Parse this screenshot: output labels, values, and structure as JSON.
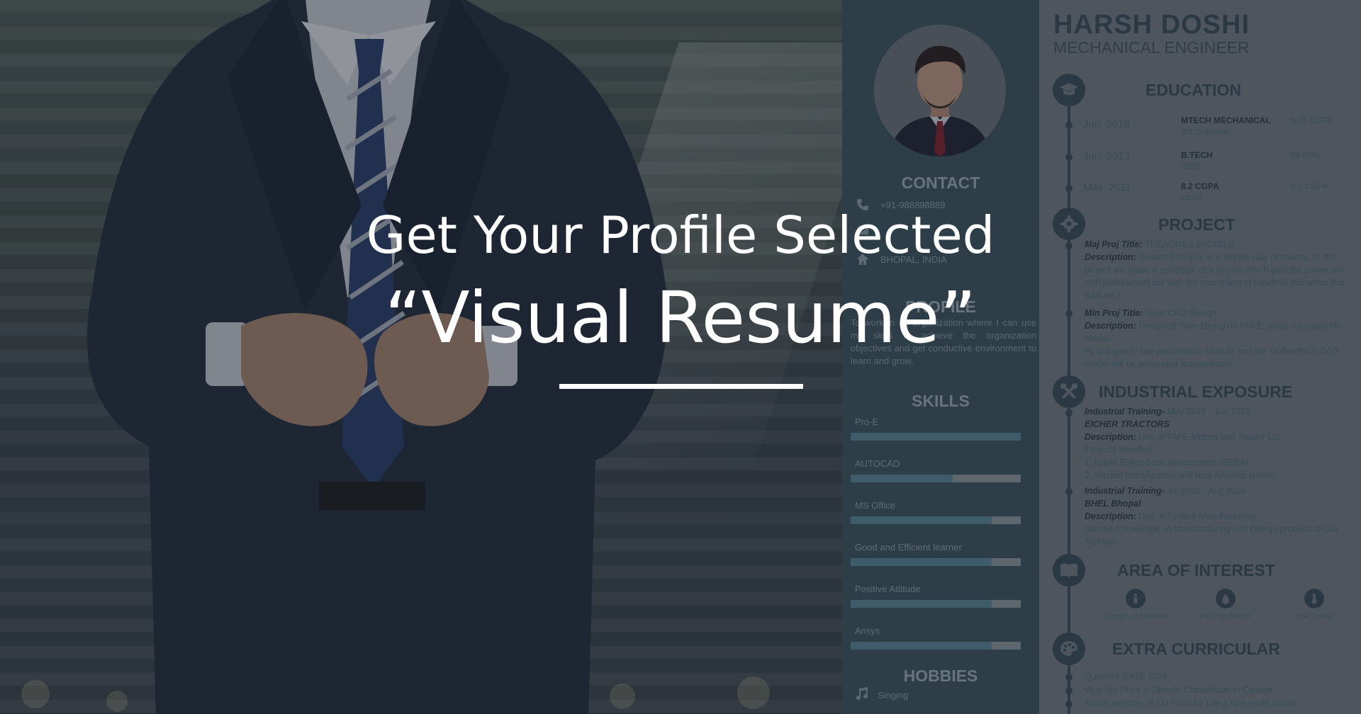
{
  "hero": {
    "headline": "Get Your Profile Selected",
    "subhead": "“Visual Resume”"
  },
  "resume": {
    "name": "HARSH DOSHI",
    "role": "MECHANICAL ENGINEER",
    "sidebar": {
      "contact_heading": "CONTACT",
      "phone": "+91-988898889",
      "location": "BHOPAL, INDIA",
      "profile_heading": "PROFILE",
      "profile_text": "To work in an organization where I can use my skills to achieve the organization objectives and get conductive environment to learn and grow.",
      "skills_heading": "SKILLS",
      "skills": [
        {
          "name": "Pro-E",
          "level": 1.0
        },
        {
          "name": "AUTOCAD",
          "level": 0.6
        },
        {
          "name": "MS Office",
          "level": 0.83
        },
        {
          "name": "Good and Efficient learner",
          "level": 0.83
        },
        {
          "name": "Positive Attitude",
          "level": 0.83
        },
        {
          "name": "Ansys",
          "level": 0.83
        }
      ],
      "hobbies_heading": "HOBBIES",
      "hobby_1": "Singing"
    },
    "education": {
      "heading": "EDUCATION",
      "rows": [
        {
          "date": "Jun, 2019",
          "degree": "MTECH MECHANICAL",
          "institute": "VIT CHENNAI",
          "score": "9.15 CGPA"
        },
        {
          "date": "Jun, 2013",
          "degree": "B.TECH",
          "institute": "CBSE",
          "score": "68.07%"
        },
        {
          "date": "May, 2011",
          "degree": "8.2 CGPA",
          "institute": "CBSE",
          "score": "8.2 CGPA"
        }
      ]
    },
    "project": {
      "heading": "PROJECT",
      "major_label": "Maj Proj Title:",
      "major_title": "TREADMILL BICYCLE",
      "desc_label": "Description:",
      "major_desc": "Treadmill bicycle is a unique way of moving. In this project we made a prototype of a bicycle which gets the power not with pedal wheel but with the movement of treadmill belt when you walk on it.",
      "minor_label": "Min Proj Title:",
      "minor_title": "Gear CAD Design",
      "minor_desc": "Designed Gear Design in Pro-E, using a parametric Model.",
      "minor_desc_2": "By using only two parameters, Module and No. of theeths a CAD model will be generated automatically."
    },
    "industrial": {
      "heading": "INDUSTRIAL EXPOSURE",
      "training_label": "Industrial Training-",
      "t1_dates": "May 2015 - Jun 2015",
      "t1_company": "EICHER TRACTORS",
      "desc_label": "Description:",
      "t1_desc": "Unit of TAFE Motors and Tractor Ltd",
      "t1_projects": "Projects Handled:",
      "t1_p1": "1. Rapid Entire Body Assessment (REBA)",
      "t1_p2": "2. Hazard Identification and Risk Analysis (HIRA)",
      "t2_dates": "Jul 2016 - Aug 2016",
      "t2_company": "BHEL Bhopal",
      "t2_desc": "Unit of Turbine Manufacturing.",
      "t2_desc_2": "Gained Knowledge on Manufacturing and Design process of Gas Turbine."
    },
    "interest": {
      "heading": "AREA OF INTEREST",
      "items": [
        "Strength of Materials",
        "Fluid Mechanics",
        "Heat Tranfer"
      ]
    },
    "extra": {
      "heading": "EXTRA CURRICULAR",
      "items": [
        "Qualified GATE 2018",
        "Won 3rd Prize in Debate Competition in College",
        "Active member of KD Food for Life a Non-profit Social"
      ]
    }
  }
}
